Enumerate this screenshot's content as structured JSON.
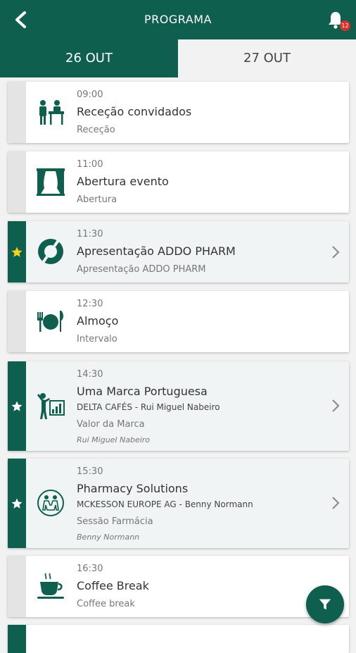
{
  "header": {
    "title": "PROGRAMA",
    "notifications": "12",
    "back_icon": "back-arrow-icon",
    "bell_icon": "bell-icon"
  },
  "tabs": [
    {
      "label": "26 OUT",
      "active": true
    },
    {
      "label": "27 OUT",
      "active": false
    }
  ],
  "colors": {
    "brand": "#0e5f4d",
    "star_highlight": "#f5d21b",
    "badge": "#d9312b"
  },
  "events": [
    {
      "time": "09:00",
      "title": "Receção convidados",
      "category": "Receção",
      "icon": "reception-icon",
      "favorite": false
    },
    {
      "time": "11:00",
      "title": "Abertura evento",
      "category": "Abertura",
      "icon": "stage-curtain-icon",
      "favorite": false
    },
    {
      "time": "11:30",
      "title": "Apresentação ADDO PHARM",
      "category": "Apresentação ADDO PHARM",
      "icon": "addo-logo-icon",
      "favorite": true,
      "star": "star-yellow-icon"
    },
    {
      "time": "12:30",
      "title": "Almoço",
      "category": "Intervalo",
      "icon": "plate-cutlery-icon",
      "favorite": false
    },
    {
      "time": "14:30",
      "title": "Uma Marca Portuguesa",
      "organization": "DELTA CAFÉS - Rui Miguel Nabeiro",
      "category": "Valor da Marca",
      "speaker": "Rui Miguel Nabeiro",
      "icon": "presenter-chart-icon",
      "favorite": true,
      "star": "star-white-icon"
    },
    {
      "time": "15:30",
      "title": "Pharmacy Solutions",
      "organization": "MCKESSON EUROPE AG - Benny Normann",
      "category": "Sessão Farmácia",
      "speaker": "Benny Normann",
      "icon": "people-circle-icon",
      "favorite": true,
      "star": "star-white-icon"
    },
    {
      "time": "16:30",
      "title": "Coffee Break",
      "category": "Coffee break",
      "icon": "coffee-cup-icon",
      "favorite": false
    }
  ],
  "fab_icon": "filter-icon"
}
